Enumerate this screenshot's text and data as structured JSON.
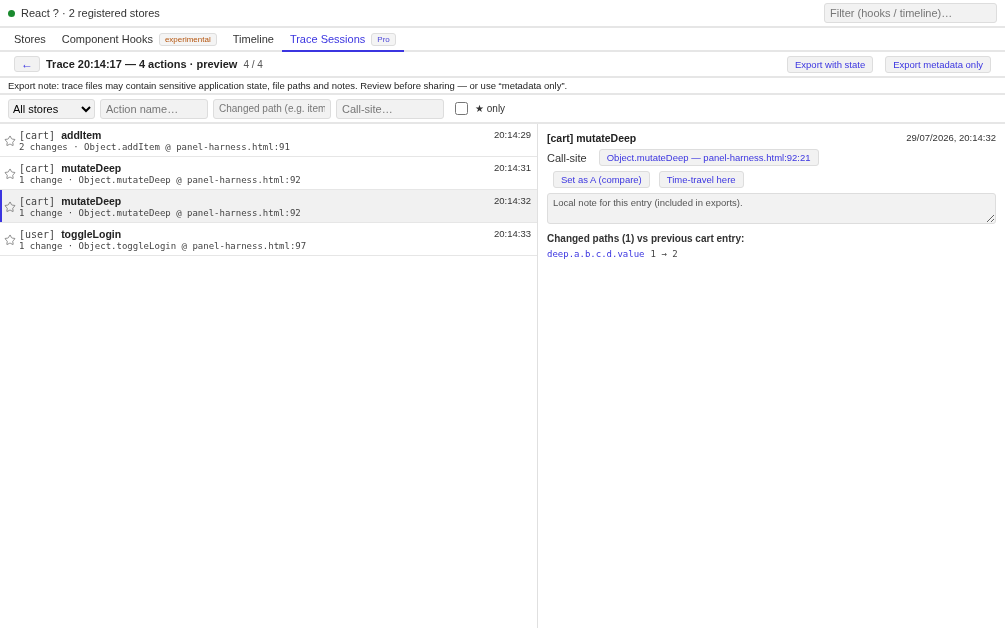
{
  "status": {
    "connected": true,
    "text": "React ? · 2 registered stores"
  },
  "global_filter": {
    "placeholder": "Filter (hooks / timeline)…"
  },
  "tabs": [
    {
      "label": "Stores",
      "selected": false
    },
    {
      "label": "Component Hooks",
      "badge": {
        "text": "experimental",
        "kind": "warning"
      },
      "selected": false
    },
    {
      "label": "Timeline",
      "selected": false
    },
    {
      "label": "Trace Sessions",
      "badge": {
        "text": "Pro",
        "kind": "info"
      },
      "selected": true
    }
  ],
  "trace_header": {
    "back": "←",
    "title": "Trace 20:14:17 — 4 actions · preview",
    "count": "4 / 4",
    "buttons": [
      "Export with state",
      "Export metadata only"
    ]
  },
  "export_note": "Export note: trace files may contain sensitive application state, file paths and notes. Review before sharing — or use “metadata only”.",
  "filters": {
    "store_select": "All stores",
    "action": {
      "placeholder": "Action name…"
    },
    "path": {
      "placeholder": "Changed path (e.g. item"
    },
    "callsite": {
      "placeholder": "Call-site…"
    },
    "starred_only": {
      "label": "★ only",
      "checked": false
    }
  },
  "entries": [
    {
      "store": "[cart]",
      "action": "addItem",
      "meta": "2 changes · Object.addItem @ panel-harness.html:91",
      "time": "20:14:29",
      "starred": false,
      "selected": false
    },
    {
      "store": "[cart]",
      "action": "mutateDeep",
      "meta": "1 change · Object.mutateDeep @ panel-harness.html:92",
      "time": "20:14:31",
      "starred": false,
      "selected": false
    },
    {
      "store": "[cart]",
      "action": "mutateDeep",
      "meta": "1 change · Object.mutateDeep @ panel-harness.html:92",
      "time": "20:14:32",
      "starred": false,
      "selected": true
    },
    {
      "store": "[user]",
      "action": "toggleLogin",
      "meta": "1 change · Object.toggleLogin @ panel-harness.html:97",
      "time": "20:14:33",
      "starred": false,
      "selected": false
    }
  ],
  "detail": {
    "title": "[cart] mutateDeep",
    "datetime": "29/07/2026, 20:14:32",
    "callsite_label": "Call-site",
    "callsite": "Object.mutateDeep — panel-harness.html:92:21",
    "buttons": [
      "Set as A (compare)",
      "Time-travel here"
    ],
    "note": {
      "placeholder": "Local note for this entry (included in exports)."
    },
    "changes_heading": "Changed paths (1) vs previous cart entry:",
    "changes": [
      {
        "path": "deep.a.b.c.d.value",
        "change": "1 → 2"
      }
    ]
  }
}
